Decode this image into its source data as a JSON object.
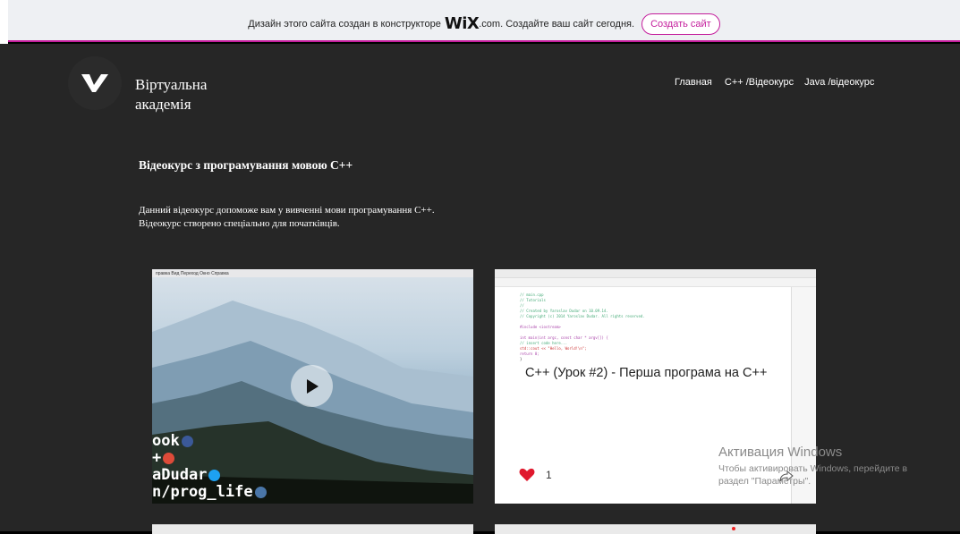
{
  "banner": {
    "text_before": "Дизайн этого сайта создан в конструкторе",
    "logo_main": "WiX",
    "text_after": ".com. Создайте ваш сайт сегодня.",
    "button": "Создать сайт",
    "accent": "#c41d9c"
  },
  "site": {
    "logo_icon": "check-v-icon",
    "title_line1": "Віртуальна",
    "title_line2": "академія"
  },
  "nav": {
    "items": [
      "Главная",
      "C++ /Відеокурс",
      "Java /відеокурс"
    ]
  },
  "content": {
    "heading": "Відеокурс з програмування мовою С++",
    "description": "Данний відеокурс допоможе вам у вивченні мови програмування С++. Відеокурс створено спеціально для початківців."
  },
  "video1": {
    "menu_text": "правка   Вид   Переход   Окно   Справка",
    "social_lines": [
      "ook",
      "+",
      "aDudar",
      "n/prog_life"
    ],
    "play_icon": "play-icon"
  },
  "video2": {
    "title": "С++ (Урок #2) - Перша програма на С++",
    "likes": "1",
    "like_icon": "heart-icon",
    "share_icon": "share-icon",
    "code_lines": [
      "// main.cpp",
      "// Tutorials",
      "//",
      "// Created by Yaroslav Dudar on 10.09.14.",
      "// Copyright (c) 2014 Yaroslav Dudar. All rights reserved.",
      "",
      "#include <iostream>",
      "",
      "int main(int argc, const char * argv[]) {",
      "    // insert code here...",
      "    std::cout << \"Hello, World!\\n\";",
      "    return 0;",
      "}"
    ]
  },
  "watermark": {
    "line1": "Активация Windows",
    "line2": "Чтобы активировать Windows, перейдите в",
    "line3": "раздел \"Параметры\"."
  }
}
